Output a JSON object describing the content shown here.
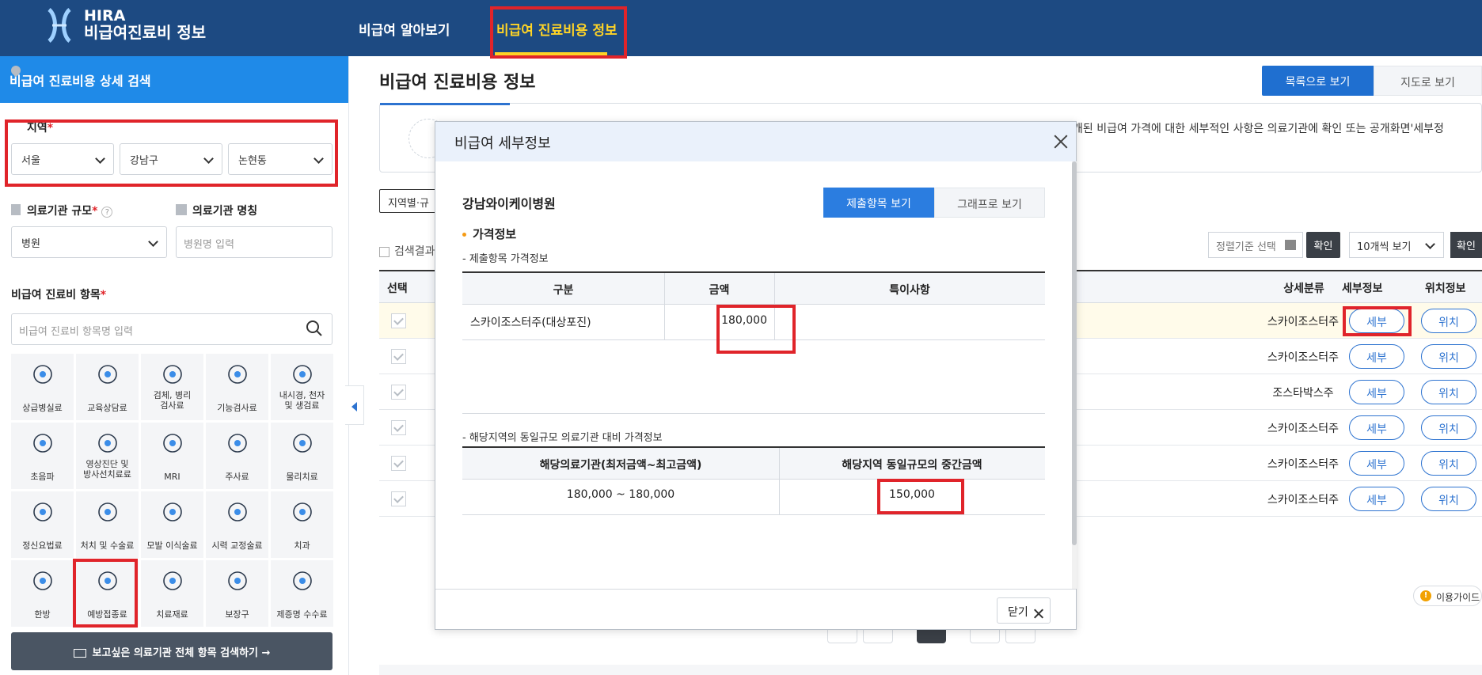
{
  "header": {
    "logo_line1": "HIRA",
    "logo_line2": "비급여진료비 정보",
    "nav": [
      "비급여 알아보기",
      "비급여 진료비용 정보"
    ]
  },
  "sidebar": {
    "title": "비급여 진료비용 상세 검색",
    "region_label": "지역",
    "region": {
      "city": "서울",
      "district": "강남구",
      "dong": "논현동"
    },
    "scale_label": "의료기관 규모",
    "scale_value": "병원",
    "name_label": "의료기관 명칭",
    "name_placeholder": "병원명 입력",
    "item_label": "비급여 진료비 항목",
    "item_placeholder": "비급여 진료비 항목명 입력",
    "categories": [
      [
        "상급병실료"
      ],
      [
        "교육상담료"
      ],
      [
        "검체, 병리",
        "검사료"
      ],
      [
        "기능검사료"
      ],
      [
        "내시경, 천자",
        "및 생검료"
      ],
      [
        "초음파"
      ],
      [
        "영상진단 및",
        "방사선치료료"
      ],
      [
        "MRI"
      ],
      [
        "주사료"
      ],
      [
        "물리치료"
      ],
      [
        "정신요법료"
      ],
      [
        "처치 및 수술료"
      ],
      [
        "모발 이식술료"
      ],
      [
        "시력 교정술료"
      ],
      [
        "치과"
      ],
      [
        "한방"
      ],
      [
        "예방접종료"
      ],
      [
        "치료재료"
      ],
      [
        "보장구"
      ],
      [
        "제증명 수수료"
      ]
    ],
    "bottom_button": "보고싶은 의료기관 전체 항목 검색하기"
  },
  "main": {
    "title": "비급여 진료비용 정보",
    "view_list": "목록으로 보기",
    "view_map": "지도로 보기",
    "info_text_line1": "개된 비급여 가격에 대한 세부적인 사항은 의료기관에 확인 또는 공개화면'세부정",
    "info_text_line2": "",
    "filter_chip": "지역별·규",
    "result_label": "검색결과",
    "sort_placeholder": "정렬기준 선택",
    "confirm": "확인",
    "page_size": "10개씩 보기",
    "col_select": "선택",
    "col_category": "상세분류",
    "col_detail": "세부정보",
    "col_location": "위치정보",
    "rows": [
      {
        "category": "스카이조스터주",
        "detail": "세부",
        "location": "위치"
      },
      {
        "category": "스카이조스터주",
        "detail": "세부",
        "location": "위치"
      },
      {
        "category": "조스타박스주",
        "detail": "세부",
        "location": "위치"
      },
      {
        "category": "스카이조스터주",
        "detail": "세부",
        "location": "위치"
      },
      {
        "category": "스카이조스터주",
        "detail": "세부",
        "location": "위치"
      },
      {
        "category": "스카이조스터주",
        "detail": "세부",
        "location": "위치"
      }
    ],
    "guide": "이용가이드"
  },
  "modal": {
    "title": "비급여 세부정보",
    "hospital": "강남와이케이병원",
    "tab_submit": "제출항목 보기",
    "tab_graph": "그래프로 보기",
    "section": "가격정보",
    "sub1": "- 제출항목 가격정보",
    "t1_headers": [
      "구분",
      "금액",
      "특이사항"
    ],
    "t1_item": "스카이조스터주(대상포진)",
    "t1_price": "180,000",
    "t1_note": "",
    "sub2": "- 해당지역의 동일규모 의료기관 대비 가격정보",
    "t2_headers": [
      "해당의료기관(최저금액~최고금액)",
      "해당지역 동일규모의 중간금액"
    ],
    "t2_range": "180,000 ~ 180,000",
    "t2_median": "150,000",
    "close": "닫기"
  }
}
